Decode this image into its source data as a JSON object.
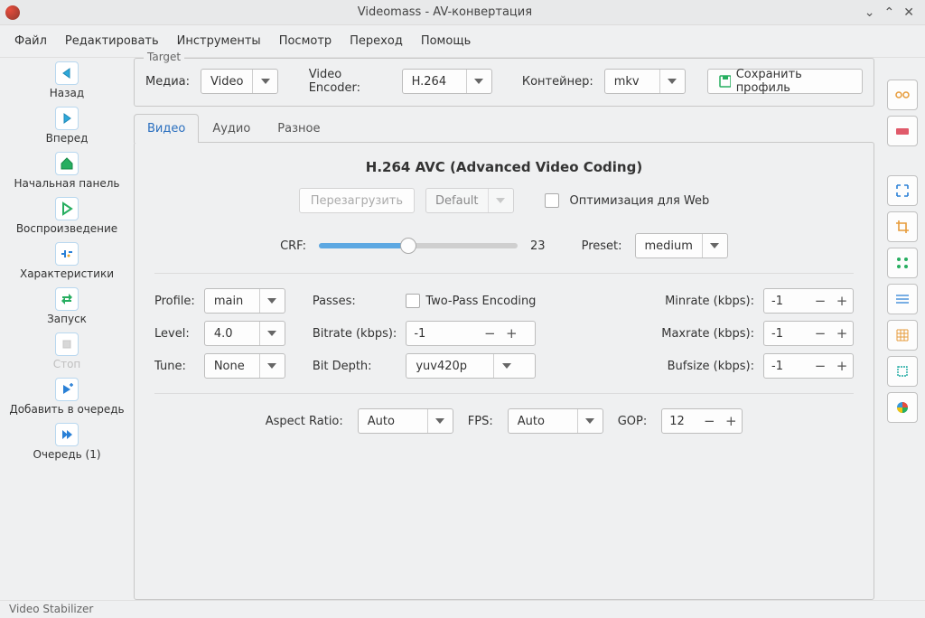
{
  "title": "Videomass - AV-конвертация",
  "menu": [
    "Файл",
    "Редактировать",
    "Инструменты",
    "Посмотр",
    "Переход",
    "Помощь"
  ],
  "toolbar": {
    "back": "Назад",
    "forward": "Вперед",
    "home": "Начальная панель",
    "play": "Воспроизведение",
    "stats": "Характеристики",
    "run": "Запуск",
    "stop": "Стоп",
    "queue_add": "Добавить в очередь",
    "queue": "Очередь (1)"
  },
  "target": {
    "legend": "Target",
    "media_label": "Медиа:",
    "media_value": "Video",
    "encoder_label": "Video Encoder:",
    "encoder_value": "H.264",
    "container_label": "Контейнер:",
    "container_value": "mkv",
    "save_profile": "Сохранить профиль"
  },
  "tabs": {
    "video": "Видео",
    "audio": "Аудио",
    "other": "Разное"
  },
  "video": {
    "title": "H.264 AVC (Advanced Video Coding)",
    "reload": "Перезагрузить",
    "default": "Default",
    "webopt": "Оптимизация для Web",
    "crf_label": "CRF:",
    "crf_value": "23",
    "preset_label": "Preset:",
    "preset_value": "medium",
    "profile_label": "Profile:",
    "profile_value": "main",
    "level_label": "Level:",
    "level_value": "4.0",
    "tune_label": "Tune:",
    "tune_value": "None",
    "passes_label": "Passes:",
    "twopass": "Two-Pass Encoding",
    "bitrate_label": "Bitrate (kbps):",
    "bitrate_value": "-1",
    "bitdepth_label": "Bit Depth:",
    "bitdepth_value": "yuv420p",
    "minrate_label": "Minrate (kbps):",
    "minrate_value": "-1",
    "maxrate_label": "Maxrate (kbps):",
    "maxrate_value": "-1",
    "bufsize_label": "Bufsize (kbps):",
    "bufsize_value": "-1",
    "aspect_label": "Aspect Ratio:",
    "aspect_value": "Auto",
    "fps_label": "FPS:",
    "fps_value": "Auto",
    "gop_label": "GOP:",
    "gop_value": "12"
  },
  "statusbar": "Video Stabilizer"
}
